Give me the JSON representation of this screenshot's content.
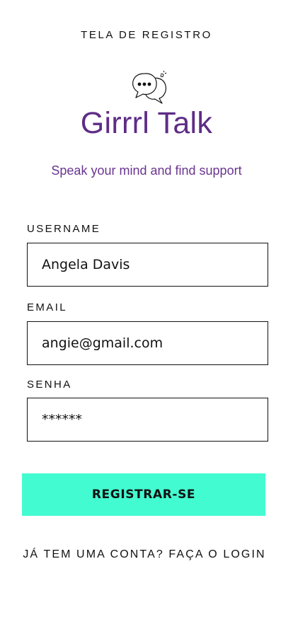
{
  "screen_title": "TELA DE REGISTRO",
  "brand": {
    "icon": "chat-bubbles-icon",
    "name": "Girrrl Talk",
    "tagline": "Speak your mind and find support",
    "color": "#5e2d86"
  },
  "form": {
    "username": {
      "label": "USERNAME",
      "value": "Angela Davis"
    },
    "email": {
      "label": "EMAIL",
      "value": "angie@gmail.com"
    },
    "password": {
      "label": "SENHA",
      "value": "******"
    }
  },
  "register_button": {
    "label": "REGISTRAR-SE",
    "color": "#43fbd0"
  },
  "login_link": "JÁ TEM UMA CONTA? FAÇA O LOGIN"
}
